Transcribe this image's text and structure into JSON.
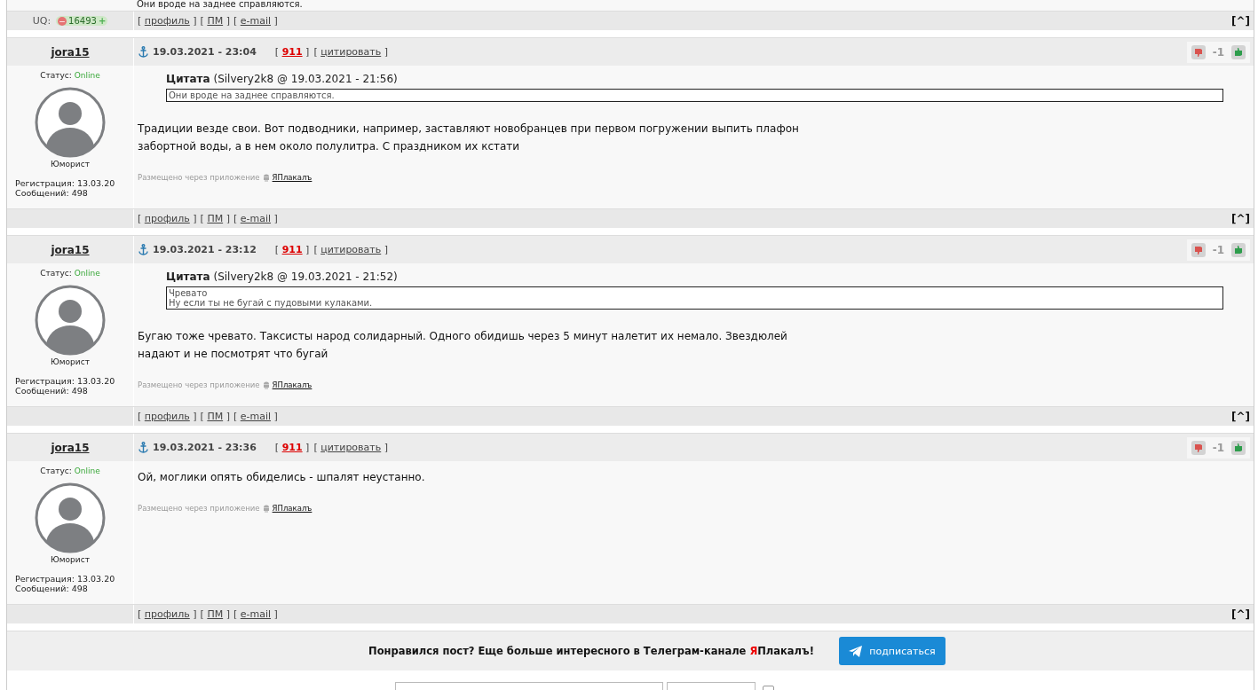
{
  "top": {
    "tail_text": "Они вроде на заднее справляются.",
    "uq_label": "UQ:",
    "uq_minus": "−",
    "uq_value": "16493",
    "uq_plus": "+",
    "links": [
      {
        "open": "[",
        "label": "профиль",
        "close": "]"
      },
      {
        "open": "[",
        "label": "ПМ",
        "close": "]"
      },
      {
        "open": "[",
        "label": "e-mail",
        "close": "]"
      }
    ],
    "up_link": "[^]"
  },
  "posts": [
    {
      "author": "jora15",
      "status_label": "Статус:",
      "status": "Online",
      "rank": "Юморист",
      "registered": "Регистрация: 13.03.20",
      "messages": "Сообщений: 498",
      "date": "19.03.2021 - 23:04",
      "id_link": {
        "open": "[",
        "label": "911",
        "close": "]"
      },
      "quote_link": {
        "open": "[",
        "label": "цитировать",
        "close": "]"
      },
      "rating": "-1",
      "quote": {
        "title": "Цитата",
        "source": "(Silvery2k8 @ 19.03.2021 - 21:56)",
        "lines": [
          "Они вроде на заднее справляются."
        ]
      },
      "body_lines": [
        "Традиции везде свои. Вот подводники, например, заставляют новобранцев при первом погружении выпить плафон",
        "забортной воды, а в нем около полулитра. С праздником их кстати"
      ],
      "via": "Размещено через приложение",
      "app": "ЯПлакалъ",
      "links": [
        {
          "open": "[",
          "label": "профиль",
          "close": "]"
        },
        {
          "open": "[",
          "label": "ПМ",
          "close": "]"
        },
        {
          "open": "[",
          "label": "e-mail",
          "close": "]"
        }
      ],
      "up_link": "[^]"
    },
    {
      "author": "jora15",
      "status_label": "Статус:",
      "status": "Online",
      "rank": "Юморист",
      "registered": "Регистрация: 13.03.20",
      "messages": "Сообщений: 498",
      "date": "19.03.2021 - 23:12",
      "id_link": {
        "open": "[",
        "label": "911",
        "close": "]"
      },
      "quote_link": {
        "open": "[",
        "label": "цитировать",
        "close": "]"
      },
      "rating": "-1",
      "quote": {
        "title": "Цитата",
        "source": "(Silvery2k8 @ 19.03.2021 - 21:52)",
        "lines": [
          "Чревато",
          "Ну если ты не бугай с пудовыми кулаками."
        ]
      },
      "body_lines": [
        "Бугаю тоже чревато. Таксисты народ солидарный. Одного обидишь через 5 минут налетит их немало. Звездюлей",
        "надают и не посмотрят что бугай"
      ],
      "via": "Размещено через приложение",
      "app": "ЯПлакалъ",
      "links": [
        {
          "open": "[",
          "label": "профиль",
          "close": "]"
        },
        {
          "open": "[",
          "label": "ПМ",
          "close": "]"
        },
        {
          "open": "[",
          "label": "e-mail",
          "close": "]"
        }
      ],
      "up_link": "[^]"
    },
    {
      "author": "jora15",
      "status_label": "Статус:",
      "status": "Online",
      "rank": "Юморист",
      "registered": "Регистрация: 13.03.20",
      "messages": "Сообщений: 498",
      "date": "19.03.2021 - 23:36",
      "id_link": {
        "open": "[",
        "label": "911",
        "close": "]"
      },
      "quote_link": {
        "open": "[",
        "label": "цитировать",
        "close": "]"
      },
      "rating": "-1",
      "body_lines": [
        "Ой, моглики опять обиделись - шпалят неустанно."
      ],
      "via": "Размещено через приложение",
      "app": "ЯПлакалъ",
      "links": [
        {
          "open": "[",
          "label": "профиль",
          "close": "]"
        },
        {
          "open": "[",
          "label": "ПМ",
          "close": "]"
        },
        {
          "open": "[",
          "label": "e-mail",
          "close": "]"
        }
      ],
      "up_link": "[^]"
    }
  ],
  "banner": {
    "text": "Понравился пост? Еще больше интересного в Телеграм-канале",
    "brand_accent": "Я",
    "brand_rest": "Плакалъ",
    "brand_end": "!",
    "button": "подписаться"
  },
  "form": {
    "checked": false
  }
}
